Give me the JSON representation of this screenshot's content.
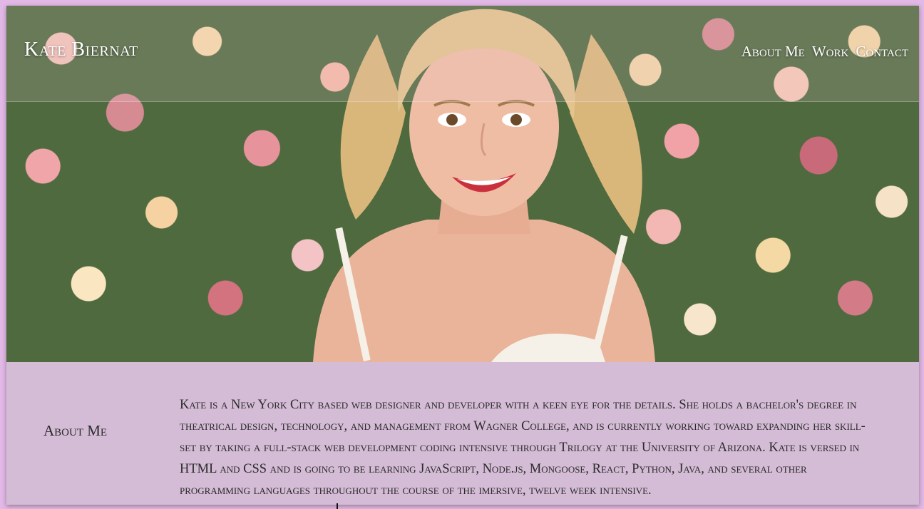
{
  "header": {
    "brand": "Kate Biernat",
    "nav": [
      "About Me",
      "Work",
      "Contact"
    ]
  },
  "hero": {
    "image": "portrait-photo"
  },
  "about": {
    "label": "About Me",
    "text": "Kate is a New York City based web designer and developer with a keen eye for the details. She holds a bachelor's degree in theatrical design, technology, and management from Wagner College, and is currently working toward expanding her skill-set by taking a full-stack web development coding intensive through Trilogy at the University of Arizona. Kate is versed in HTML and CSS and is going to be learning JavaScript, Node.js, Mongoose, React, Python, Java, and several other programming languages throughout the course of the imersive, twelve week intensive."
  },
  "colors": {
    "page_background": "#e2b8e6",
    "about_background": "#d4bbd6",
    "text": "#2a2a2a",
    "header_text": "#ffffff"
  }
}
